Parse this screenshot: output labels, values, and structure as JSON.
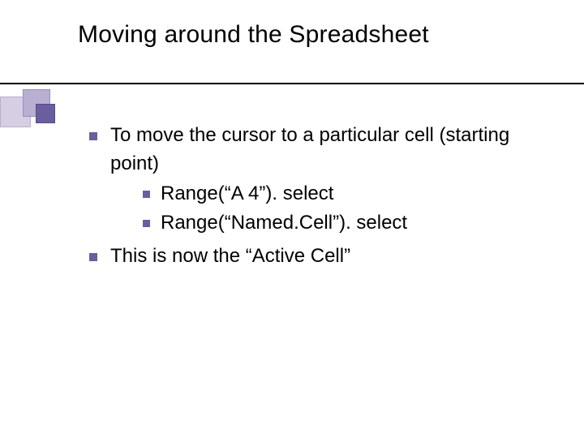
{
  "title": "Moving around the Spreadsheet",
  "bullets": {
    "b1": "To move the cursor to a particular cell (starting point)",
    "b1_sub1": "Range(“A 4”). select",
    "b1_sub2": "Range(“Named.Cell”). select",
    "b2": "This is now the “Active Cell”"
  }
}
